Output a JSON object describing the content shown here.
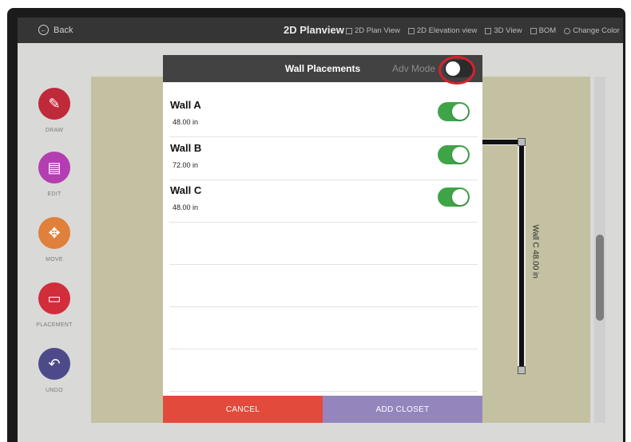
{
  "topbar": {
    "back_label": "Back",
    "title": "2D Planview",
    "nav": [
      {
        "label": "2D Plan View",
        "icon": "plan-icon"
      },
      {
        "label": "2D Elevation view",
        "icon": "elevation-icon"
      },
      {
        "label": "3D View",
        "icon": "cube-icon"
      },
      {
        "label": "BOM",
        "icon": "document-icon"
      },
      {
        "label": "Change Color",
        "icon": "palette-icon"
      }
    ]
  },
  "tools": [
    {
      "label": "DRAW",
      "color": "#c0293a",
      "icon": "pencil-icon"
    },
    {
      "label": "EDIT",
      "color": "#b33eb0",
      "icon": "ruler-icon"
    },
    {
      "label": "MOVE",
      "color": "#e0803a",
      "icon": "move-arrows-icon"
    },
    {
      "label": "PLACEMENT",
      "color": "#d22d3a",
      "icon": "placement-icon"
    },
    {
      "label": "UNDO",
      "color": "#4d4a8a",
      "icon": "undo-icon"
    }
  ],
  "plan": {
    "wall_label": "Wall C 48.00 in"
  },
  "modal": {
    "title": "Wall Placements",
    "adv_mode_label": "Adv Mode",
    "adv_mode_on": false,
    "walls": [
      {
        "name": "Wall A",
        "length": "48.00 in",
        "enabled": true
      },
      {
        "name": "Wall B",
        "length": "72.00 in",
        "enabled": true
      },
      {
        "name": "Wall C",
        "length": "48.00 in",
        "enabled": true
      }
    ],
    "cancel_label": "CANCEL",
    "add_closet_label": "ADD CLOSET"
  },
  "colors": {
    "toggle_on": "#3fa447",
    "cancel": "#e24a3b",
    "add_closet": "#9486bd",
    "highlight": "#d8202b"
  }
}
